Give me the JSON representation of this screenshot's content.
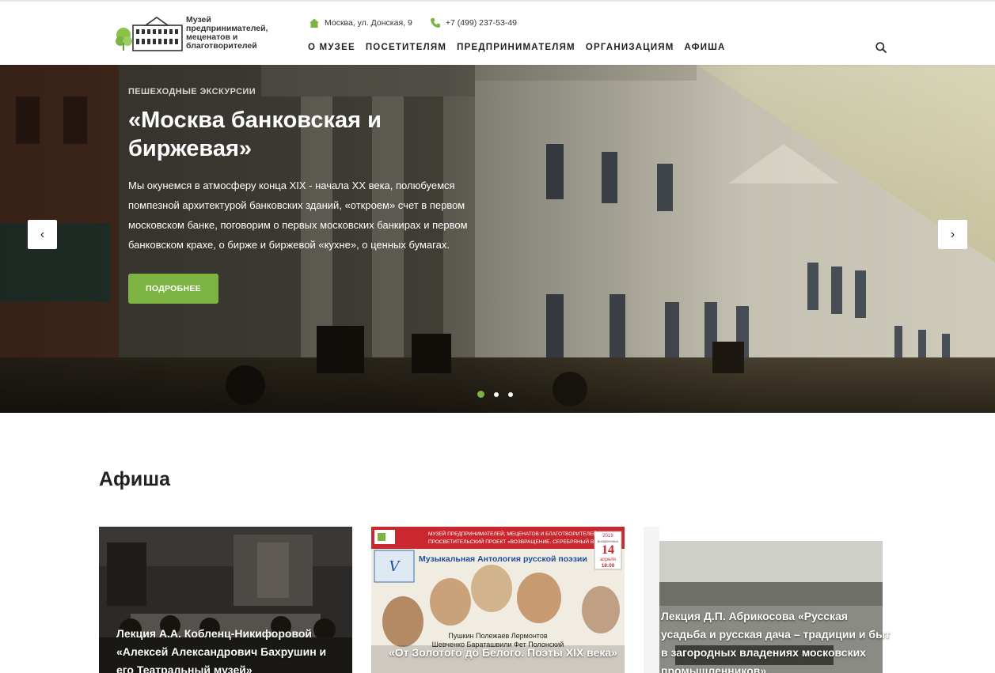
{
  "header": {
    "logo_text": "Музей предпринимателей, меценатов и благотворителей",
    "address": "Москва, ул. Донская, 9",
    "phone": "+7 (499) 237-53-49",
    "nav": [
      "О МУЗЕЕ",
      "ПОСЕТИТЕЛЯМ",
      "ПРЕДПРИНИМАТЕЛЯМ",
      "ОРГАНИЗАЦИЯМ",
      "АФИША"
    ]
  },
  "hero": {
    "category": "ПЕШЕХОДНЫЕ ЭКСКУРСИИ",
    "title": "«Москва банковская и биржевая»",
    "description": "Мы окунемся в атмосферу конца XIX - начала XX века, полюбуемся помпезной архитектурой банковских зданий, «откроем» счет в первом московском банке, поговорим о первых московских банкирах и первом банковском крахе, о бирже и биржевой «кухне», о ценных бумагах.",
    "button": "ПОДРОБНЕЕ",
    "prev_glyph": "‹",
    "next_glyph": "›",
    "slides_count": 3,
    "active_slide": 1
  },
  "afisha": {
    "title": "Афиша",
    "cards": [
      {
        "title": "Лекция А.А. Кобленц-Никифоровой «Алексей Александрович Бахрушин и его Театральный музей»"
      },
      {
        "title": "«От Золотого до Белого. Поэты XIX века»"
      },
      {
        "title": "Лекция Д.П. Абрикосова «Русская усадьба и русская дача – традиции и быт в загородных владениях московских промышленников»"
      }
    ]
  },
  "poster": {
    "header_line1": "МУЗЕЙ ПРЕДПРИНИМАТЕЛЕЙ, МЕЦЕНАТОВ И БЛАГОТВОРИТЕЛЕЙ",
    "header_line2": "ПРОСВЕТИТЕЛЬСКИЙ ПРОЕКТ «ВОЗВРАЩЕНИЕ. СЕРЕБРЯНЫЙ ВЕК»",
    "anthology": "Музыкальная Антология русской поэзии",
    "year": "2019",
    "weekday": "воскресенье",
    "day": "14",
    "month": "апреля",
    "time": "18:00",
    "poets_line1": "Пушкин Полежаев Лермонтов",
    "poets_line2": "Шевченко Бараташвили Фет Полонский"
  },
  "colors": {
    "accent": "#7cb342",
    "text": "#222222",
    "white": "#ffffff"
  },
  "icons": {
    "home": "home-icon",
    "phone": "phone-icon",
    "search": "search-icon"
  }
}
